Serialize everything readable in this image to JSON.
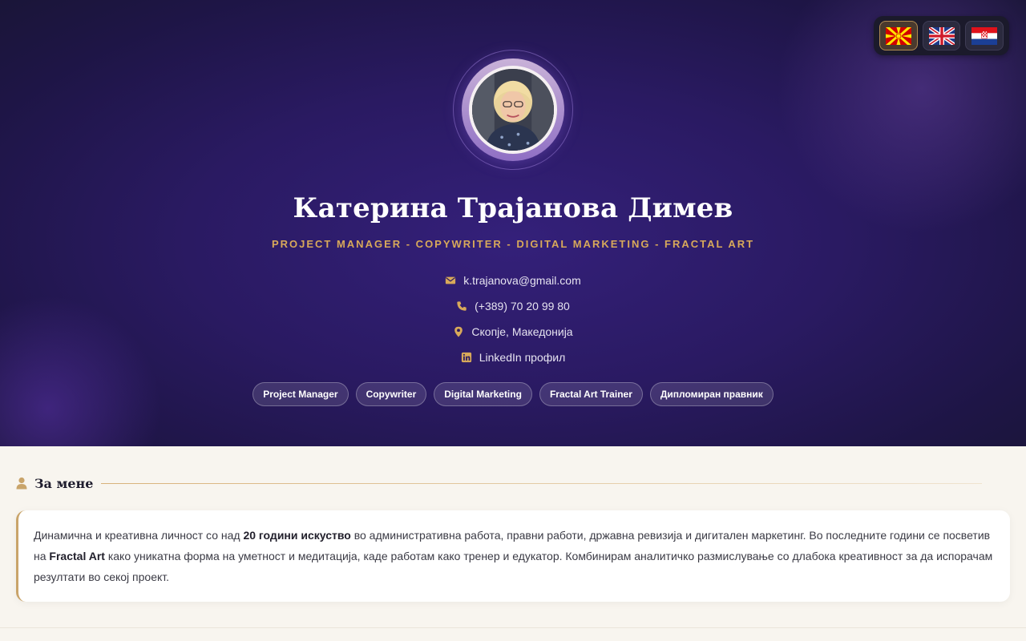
{
  "languages": [
    {
      "code": "mk",
      "icon": "macedonia-flag-icon",
      "active": true
    },
    {
      "code": "en",
      "icon": "uk-flag-icon",
      "active": false
    },
    {
      "code": "hr",
      "icon": "croatia-flag-icon",
      "active": false
    }
  ],
  "profile": {
    "name": "Катерина Трајанова Димев",
    "subtitle": "PROJECT MANAGER - COPYWRITER - DIGITAL MARKETING - FRACTAL ART"
  },
  "contacts": {
    "email": {
      "icon": "envelope-icon",
      "text": "k.trajanova@gmail.com"
    },
    "phone": {
      "icon": "phone-icon",
      "text": "(+389) 70 20 99 80"
    },
    "location": {
      "icon": "map-pin-icon",
      "text": "Скопје, Македонија"
    },
    "linkedin": {
      "icon": "linkedin-icon",
      "text": "LinkedIn профил"
    }
  },
  "tags": [
    "Project Manager",
    "Copywriter",
    "Digital Marketing",
    "Fractal Art Trainer",
    "Дипломиран правник"
  ],
  "about": {
    "icon": "user-icon",
    "title": "За мене",
    "text_1": "Динамична и креативна личност со над ",
    "bold_1": "20 години искуство",
    "text_2": " во административна работа, правни работи, државна ревизија и дигитален маркетинг. Во последните години се посветив на ",
    "bold_2": "Fractal Art",
    "text_3": " како уникатна форма на уметност и медитација, каде работам како тренер и едукатор. Комбинирам аналитичко размислување со длабока креативност за да испорачам резултати во секој проект."
  },
  "colors": {
    "accent_gold": "#d8a95a",
    "hero_purple": "#2a1a62",
    "page_background": "#f8f5ef"
  }
}
